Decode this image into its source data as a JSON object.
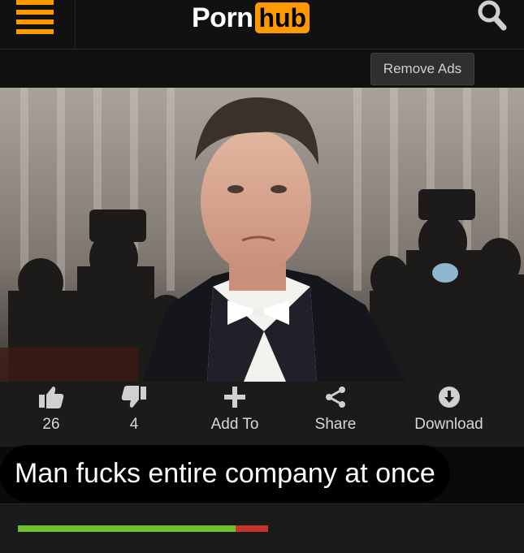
{
  "header": {
    "logo_word_1": "Porn",
    "logo_word_2": "hub",
    "menu_icon": "hamburger-icon",
    "search_icon": "search-icon"
  },
  "ad_bar": {
    "remove_ads_label": "Remove Ads"
  },
  "actions": {
    "likes": "26",
    "dislikes": "4",
    "add_to_label": "Add To",
    "share_label": "Share",
    "download_label": "Download"
  },
  "caption": "Man fucks entire company at once",
  "rating": {
    "like_fraction": 0.87
  },
  "colors": {
    "accent": "#ff9900",
    "like": "#6cbf2f",
    "dislike": "#c9342a"
  }
}
